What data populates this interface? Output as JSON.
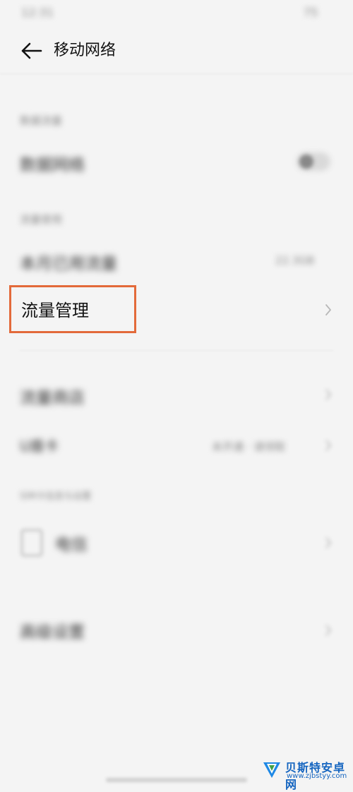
{
  "status_bar": {
    "time": "12:31",
    "battery": "75"
  },
  "header": {
    "title": "移动网络"
  },
  "sections": {
    "data_section_label": "数据流量",
    "mobile_data_label": "数据网络",
    "usage_section_label": "流量使用",
    "monthly_usage_label": "本月已用流量",
    "monthly_usage_value": "22.3GB",
    "flow_manage_label": "流量管理",
    "flow_package_label": "流量商店",
    "sim_label": "U盾卡",
    "sim_value": "未开通 · 请领取",
    "sim_settings_section_label": "SIM卡信息与设置",
    "carrier_label": "电信",
    "advanced_label": "高级设置"
  },
  "watermark": {
    "title": "贝斯特安卓网",
    "url": "www.zjbstyy.com"
  },
  "colors": {
    "highlight": "#e36a3a",
    "background": "#f4f4f4",
    "watermark": "#1565c0"
  },
  "icons": {
    "back": "back-arrow-icon",
    "chevron": "chevron-right-icon",
    "sim": "sim-card-icon"
  }
}
